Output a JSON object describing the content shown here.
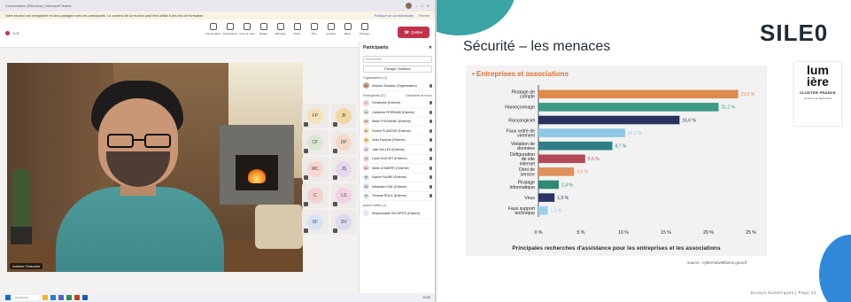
{
  "teams": {
    "window_title": "Conversation (Réunion) | Microsoft Teams",
    "banner_text": "Votre réunion est enregistrée et sera partagée avec les participants. Le contenu de la réunion peut être utilisé à des fins de formation.",
    "banner_links": [
      "Politique de confidentialité",
      "Fermer"
    ],
    "timer": "1:01",
    "tools": [
      {
        "label": "Conversation",
        "icon": "chat-icon"
      },
      {
        "label": "Participants",
        "icon": "people-icon"
      },
      {
        "label": "Lever la main",
        "icon": "hand-icon"
      },
      {
        "label": "Réagir",
        "icon": "smile-icon"
      },
      {
        "label": "Affichage",
        "icon": "grid-icon"
      },
      {
        "label": "Notes",
        "icon": "notes-icon"
      },
      {
        "label": "Plus",
        "icon": "more-icon"
      },
      {
        "label": "Caméra",
        "icon": "camera-icon"
      },
      {
        "label": "Micro",
        "icon": "mic-icon"
      },
      {
        "label": "Partager",
        "icon": "share-icon"
      }
    ],
    "quit_label": "Quitter",
    "speaker_name": "Antoine Giraudon",
    "tiles": [
      "FP",
      "JF",
      "CF",
      "DP",
      "MC",
      "JS",
      "C",
      "LS",
      "SF",
      "SV"
    ],
    "panel": {
      "title": "Participants",
      "search_placeholder": "Rechercher",
      "share_label": "Partager l'invitation",
      "section_organizers": "Organisateurs (1)",
      "section_in_meeting": "Participants (22)",
      "mute_all": "Désactiver le micro",
      "section_others": "Autres invités (1)",
      "people": [
        {
          "initials": "AG",
          "name": "Antoine Giraudon (Organisateur)",
          "color": "#c7a27c"
        },
        {
          "initials": "C",
          "name": "Christophe (Externe)",
          "color": "#f3d1d1"
        },
        {
          "initials": "CF",
          "name": "Catherine FERRAND (Externe)",
          "color": "#d9e7d2"
        },
        {
          "initials": "DP",
          "name": "Didier POIGNAND (Externe)",
          "color": "#f6d8c6"
        },
        {
          "initials": "FP",
          "name": "Florent PLANCHE (Externe)",
          "color": "#f5e1b8"
        },
        {
          "initials": "JF",
          "name": "Jean-François (Externe)",
          "color": "#f0d9a0"
        },
        {
          "initials": "JS",
          "name": "Julie SALLES (Externe)",
          "color": "#e6d7ee"
        },
        {
          "initials": "LS",
          "name": "Laure SUCHET (Externe)",
          "color": "#f3d3e1"
        },
        {
          "initials": "MC",
          "name": "Marie CHABERT (Externe)",
          "color": "#f7d5d0"
        },
        {
          "initials": "SF",
          "name": "Sophie FAURE (Externe)",
          "color": "#d7e3f4"
        },
        {
          "initials": "SV",
          "name": "Sébastien VIAL (Externe)",
          "color": "#ddd7f0"
        },
        {
          "initials": "TR",
          "name": "Thomas ROUX (Externe)",
          "color": "#d8ede8"
        }
      ],
      "other_guest": "Responsable SECURITE (Externe)"
    },
    "taskbar": {
      "search_placeholder": "Rechercher",
      "clock": "14:05"
    }
  },
  "slide": {
    "title": "Sécurité – les menaces",
    "brand": "SILE0",
    "partner_logo": {
      "line1": "lum",
      "line2": "ière",
      "sub": "CLUSTER FRANCE",
      "tag": "Lumière sur l'Entreprise"
    },
    "chart_heading": "• Entreprises et associations",
    "chart_footer": "Principales recherches d'assistance pour les entreprises et les associations",
    "source": "source : cybermalveillance.gouv.fr",
    "pager": "Ecosys Numériques | Page 22"
  },
  "chart_data": {
    "type": "bar",
    "orientation": "horizontal",
    "title": "• Entreprises et associations",
    "xlabel": "Principales recherches d'assistance pour les entreprises et les associations",
    "categories": [
      "Piratage de compte",
      "Hameçonnage",
      "Rançongiciel",
      "Faux ordre de virement",
      "Violation de données",
      "Défiguration de site internet",
      "Déni de service",
      "Piratage informatique",
      "Virus",
      "Faux support technique"
    ],
    "values": [
      23.5,
      21.2,
      16.6,
      10.2,
      8.7,
      5.5,
      4.2,
      2.4,
      1.9,
      1.1
    ],
    "value_labels": [
      "23,5 %",
      "21,2 %",
      "16,6 %",
      "10,2 %",
      "8,7 %",
      "5,5 %",
      "4,2 %",
      "2,4 %",
      "1,9 %",
      "1,1 %"
    ],
    "colors": [
      "#de8a4e",
      "#3c9a86",
      "#283260",
      "#8ec8e6",
      "#2f7f86",
      "#b24a5a",
      "#e0905a",
      "#2d8a75",
      "#2a3468",
      "#9ad0ec"
    ],
    "xlim": [
      0,
      25
    ],
    "xticks": [
      "0 %",
      "5 %",
      "10 %",
      "15 %",
      "20 %",
      "25 %"
    ],
    "grid": false,
    "legend": "none"
  }
}
